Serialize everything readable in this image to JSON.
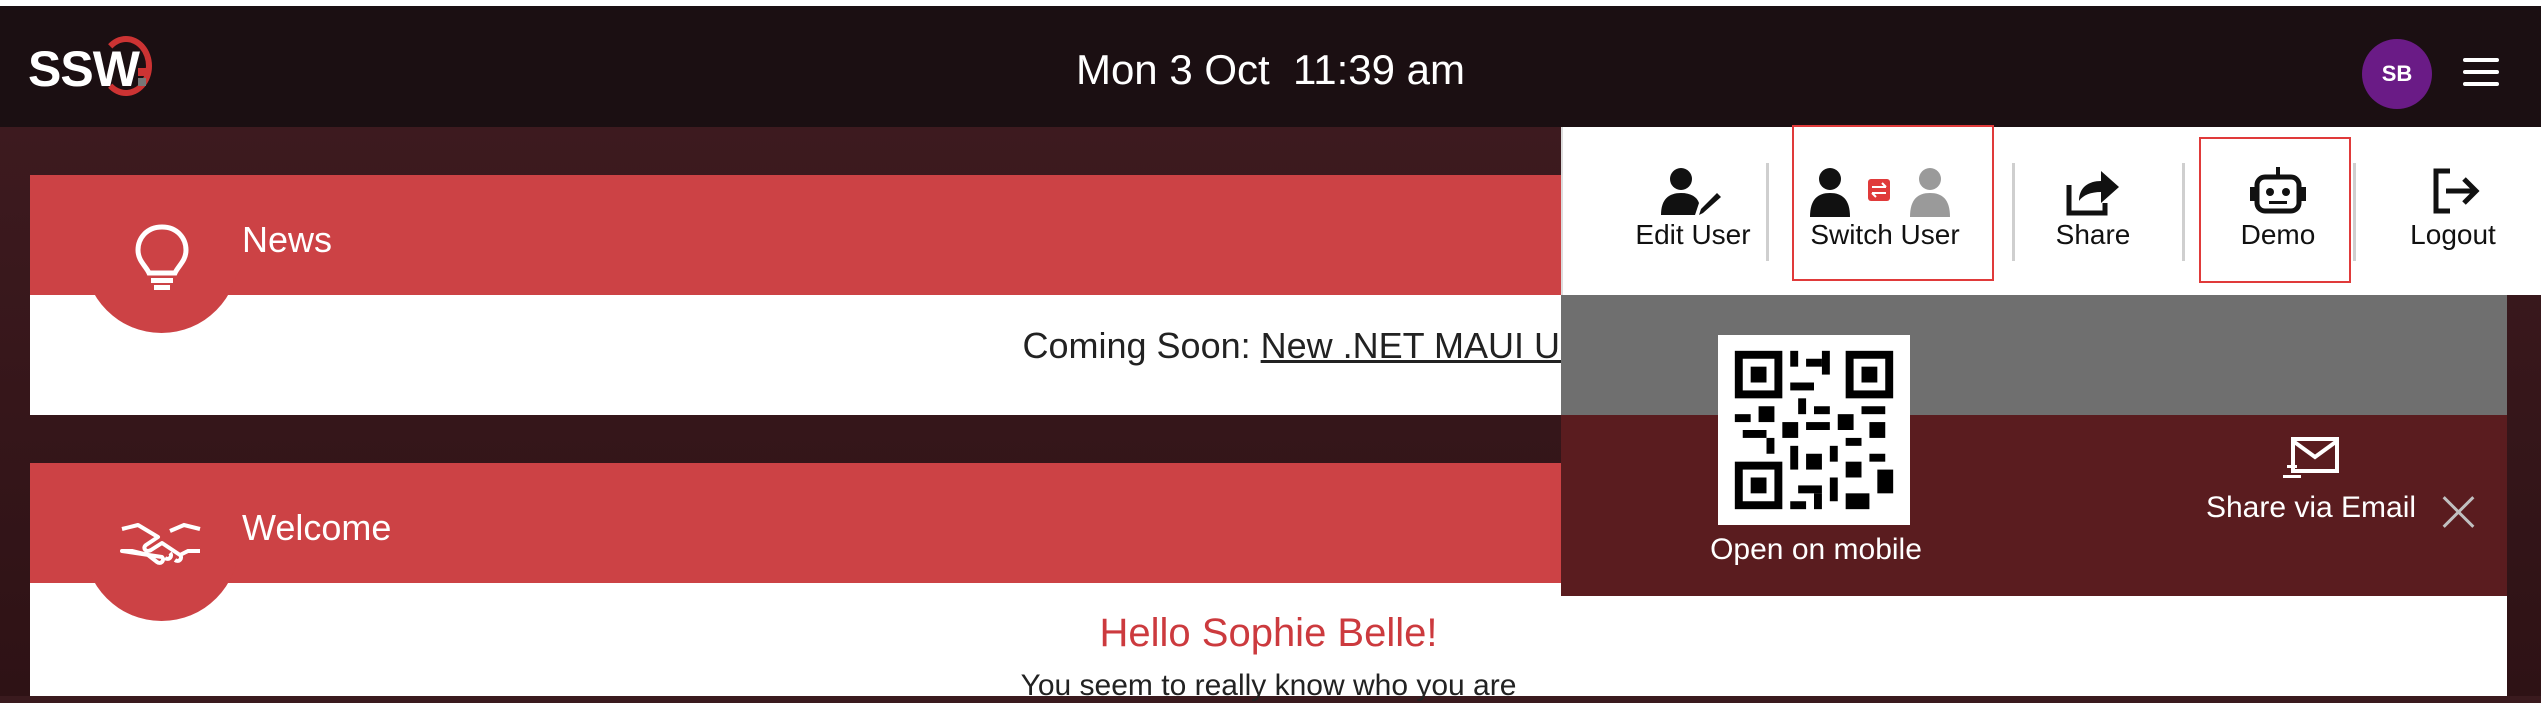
{
  "header": {
    "logo_text": "SSW",
    "datetime": "Mon 3 Oct  11:39 am",
    "avatar_initials": "SB"
  },
  "news_card": {
    "title": "News",
    "text_prefix": "Coming Soon: ",
    "link_text": "New .NET MAUI UI"
  },
  "welcome_card": {
    "title": "Welcome",
    "greeting": "Hello Sophie Belle!",
    "subtext": "You seem to really know who you are"
  },
  "user_menu": {
    "items": [
      {
        "label": "Edit User",
        "icon": "user-edit-icon"
      },
      {
        "label": "Switch User",
        "icon": "switch-user-icon"
      },
      {
        "label": "Share",
        "icon": "share-icon"
      },
      {
        "label": "Demo",
        "icon": "robot-icon"
      },
      {
        "label": "Logout",
        "icon": "logout-icon"
      }
    ]
  },
  "share_panel": {
    "qr_caption": "Open on mobile",
    "email_caption": "Share via Email"
  },
  "colors": {
    "accent_red": "#cc4245",
    "topbar": "#1b0f12",
    "avatar": "#6a1b86",
    "highlight_box": "#e03a3a"
  }
}
